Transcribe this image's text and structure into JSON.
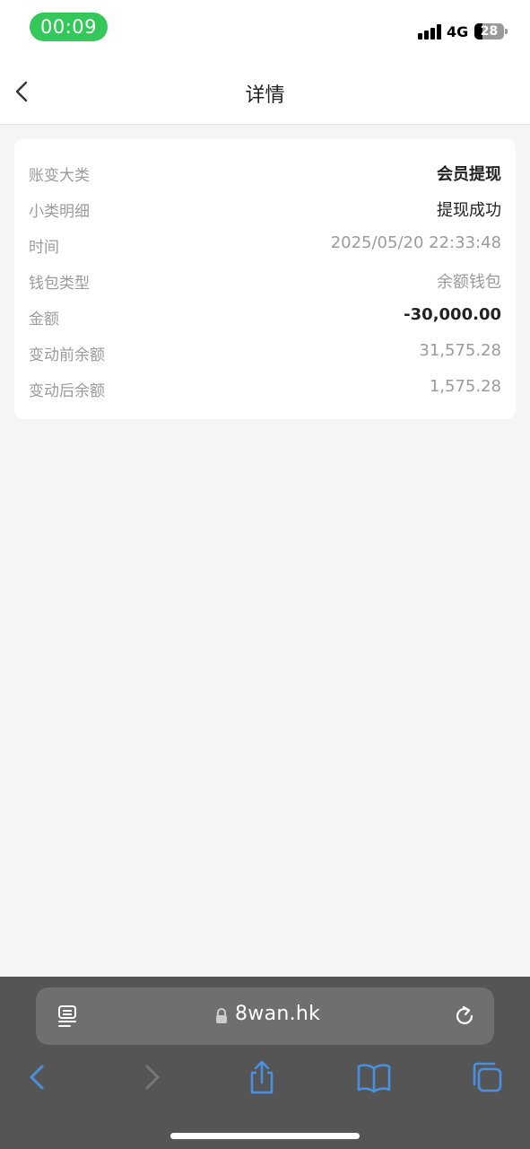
{
  "status_bar": {
    "time": "00:09",
    "network": "4G",
    "battery_percent": "28",
    "battery_level": 0.28,
    "time_pill_color": "#34c759"
  },
  "nav": {
    "back_icon": "chevron-left-icon",
    "title": "详情"
  },
  "details": {
    "rows": [
      {
        "label": "账变大类",
        "value": "会员提现"
      },
      {
        "label": "小类明细",
        "value": "提现成功"
      },
      {
        "label": "时间",
        "value": "2025/05/20 22:33:48"
      },
      {
        "label": "钱包类型",
        "value": "余额钱包"
      },
      {
        "label": "金额",
        "value": "-30,000.00"
      },
      {
        "label": "变动前余额",
        "value": "31,575.28"
      },
      {
        "label": "变动后余额",
        "value": "1,575.28"
      }
    ]
  },
  "browser": {
    "url": "8wan.hk",
    "accent_color": "#4a90e2",
    "icons": [
      "reader-menu-icon",
      "lock-icon",
      "reload-icon",
      "back-arrow-icon",
      "forward-arrow-icon",
      "share-icon",
      "bookmarks-icon",
      "tabs-icon"
    ]
  }
}
